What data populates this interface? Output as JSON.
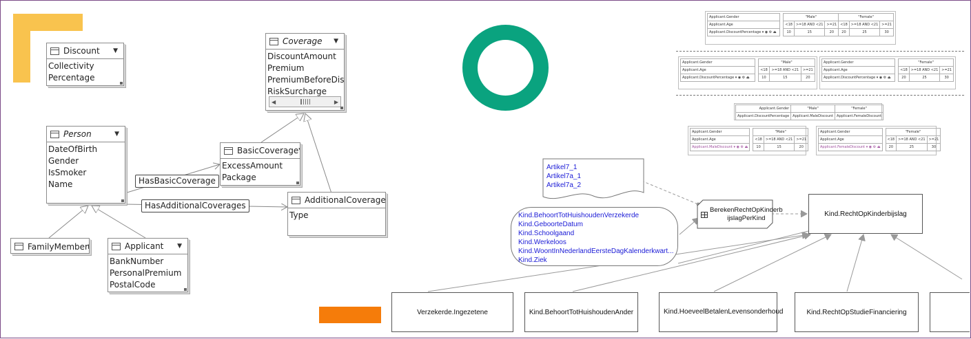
{
  "uml": {
    "discount": {
      "name": "Discount",
      "attrs": [
        "Collectivity",
        "Percentage"
      ]
    },
    "coverage": {
      "name": "Coverage",
      "attrs": [
        "DiscountAmount",
        "Premium",
        "PremiumBeforeDiscou",
        "RiskSurcharge"
      ]
    },
    "person": {
      "name": "Person",
      "attrs": [
        "DateOfBirth",
        "Gender",
        "IsSmoker",
        "Name"
      ]
    },
    "basic_coverage": {
      "name": "BasicCoverage",
      "attrs": [
        "ExcessAmount",
        "Package"
      ]
    },
    "additional_coverage": {
      "name": "AdditionalCoverage",
      "attrs": [
        "Type"
      ]
    },
    "family_member": {
      "name": "FamilyMember"
    },
    "applicant": {
      "name": "Applicant",
      "attrs": [
        "BankNumber",
        "PersonalPremium",
        "PostalCode"
      ]
    },
    "assoc_basic": "HasBasicCoverage",
    "assoc_additional": "HasAdditionalCoverages"
  },
  "tables": {
    "t1": {
      "gender_label": "Applicant.Gender",
      "age_label": "Applicant.Age",
      "discount_label": "Applicant.DiscountPercentage",
      "male": "\"Male\"",
      "female": "\"Female\"",
      "ages": [
        "<18",
        ">=18 AND <21",
        ">=21",
        "<18",
        ">=18 AND <21",
        ">=21"
      ],
      "values": [
        "10",
        "15",
        "20",
        "20",
        "25",
        "30"
      ]
    },
    "t2a": {
      "gender_label": "Applicant.Gender",
      "age_label": "Applicant.Age",
      "discount_label": "Applicant.DiscountPercentage",
      "gender_value": "\"Male\"",
      "ages": [
        "<18",
        ">=18 AND <21",
        ">=21"
      ],
      "values": [
        "10",
        "15",
        "20"
      ]
    },
    "t2b": {
      "gender_label": "Applicant.Gender",
      "age_label": "Applicant.Age",
      "discount_label": "Applicant.DiscountPercentage",
      "gender_value": "\"Female\"",
      "ages": [
        "<18",
        ">=18 AND <21",
        ">=21"
      ],
      "values": [
        "20",
        "25",
        "30"
      ]
    },
    "t3": {
      "gender_label": "Applicant.Gender",
      "male": "\"Male\"",
      "female": "\"Female\"",
      "discount_label": "Applicant.DiscountPercentage",
      "male_discount": "Applicant.MaleDiscount",
      "female_discount": "Applicant.FemaleDiscount"
    },
    "t4a": {
      "gender_label": "Applicant.Gender",
      "age_label": "Applicant.Age",
      "discount_label": "Applicant.MaleDiscount",
      "gender_value": "\"Male\"",
      "ages": [
        "<18",
        ">=18 AND <21",
        ">=21"
      ],
      "values": [
        "10",
        "15",
        "20"
      ]
    },
    "t4b": {
      "gender_label": "Applicant.Gender",
      "age_label": "Applicant.Age",
      "discount_label": "Applicant.FemaleDiscount",
      "gender_value": "\"Female\"",
      "ages": [
        "<18",
        ">=18 AND <21",
        ">=21"
      ],
      "values": [
        "20",
        "25",
        "30"
      ]
    }
  },
  "dmn": {
    "knowledge_sources": [
      "Artikel7_1",
      "Artikel7a_1",
      "Artikel7a_2"
    ],
    "inputs": [
      "Kind.BehoortTotHuishoudenVerzekerde",
      "Kind.GeboorteDatum",
      "Kind.Schoolgaand",
      "Kind.Werkeloos",
      "Kind.WoontInNederlandEersteDagKalenderkwart...",
      "Kind.Ziek"
    ],
    "decision_small_line1": "BerekenRechtOpKinderb",
    "decision_small_line2": "ijslagPerKind",
    "decision_main": "Kind.RechtOpKinderbijslag",
    "bottom": [
      "Verzekerde.Ingezetene",
      "Kind.BehoortTotHuishoudenAnder",
      "Kind.HoeveelBetalenLevensonderhoud",
      "Kind.RechtOpStudieFinanciering"
    ]
  },
  "colors": {
    "yellow": "#f9c34e",
    "orange": "#f57c0a",
    "green": "#0aa37f",
    "frame": "#7a4a86",
    "link": "#1a1ad6",
    "pink": "#a0509f"
  }
}
